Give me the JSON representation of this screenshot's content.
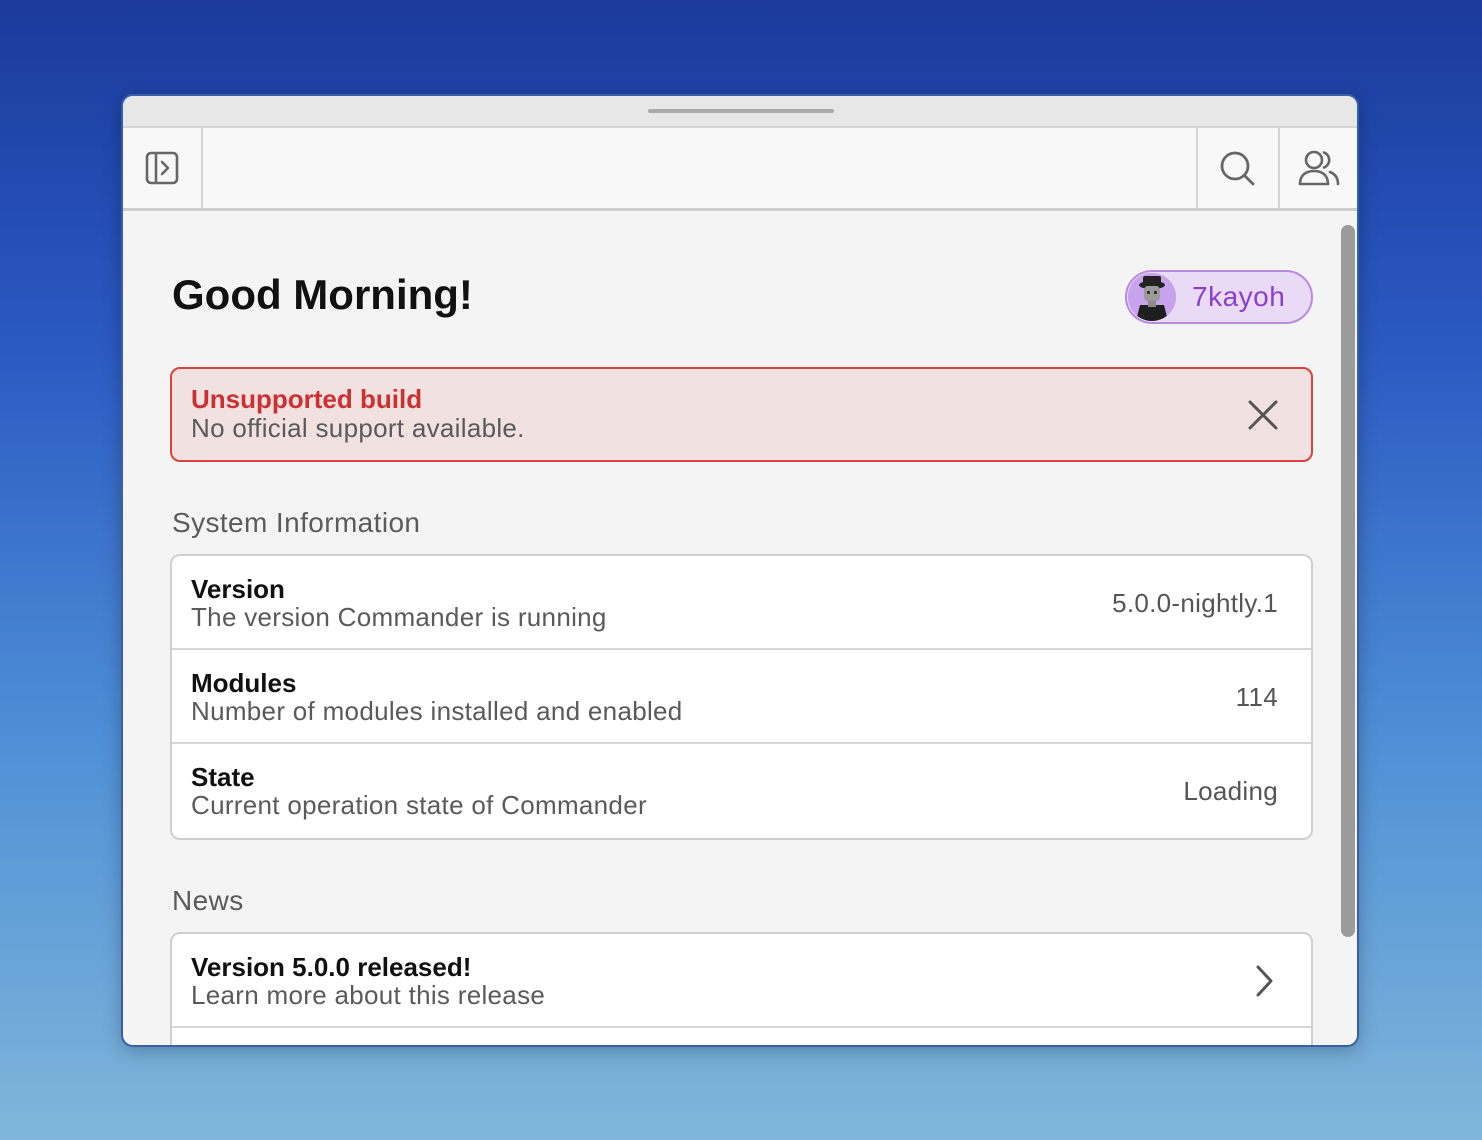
{
  "toolbar": {
    "sidebar_icon": "sidebar-toggle-icon",
    "search_icon": "search-icon",
    "users_icon": "users-icon"
  },
  "header": {
    "greeting": "Good Morning!",
    "user": {
      "name": "7kayoh",
      "avatar_icon": "avatar"
    }
  },
  "alert": {
    "title": "Unsupported build",
    "description": "No official support available.",
    "close_icon": "close-icon"
  },
  "system_info": {
    "heading": "System Information",
    "rows": [
      {
        "title": "Version",
        "description": "The version Commander is running",
        "value": "5.0.0-nightly.1"
      },
      {
        "title": "Modules",
        "description": "Number of modules installed and enabled",
        "value": "114"
      },
      {
        "title": "State",
        "description": "Current operation state of Commander",
        "value": "Loading"
      }
    ]
  },
  "news": {
    "heading": "News",
    "items": [
      {
        "title": "Version 5.0.0 released!",
        "description": "Learn more about this release",
        "icon": "chevron-right-icon"
      }
    ]
  },
  "colors": {
    "accent_purple": "#8a3fd0",
    "alert_red": "#cd3030",
    "alert_bg": "#f2e1e1"
  }
}
